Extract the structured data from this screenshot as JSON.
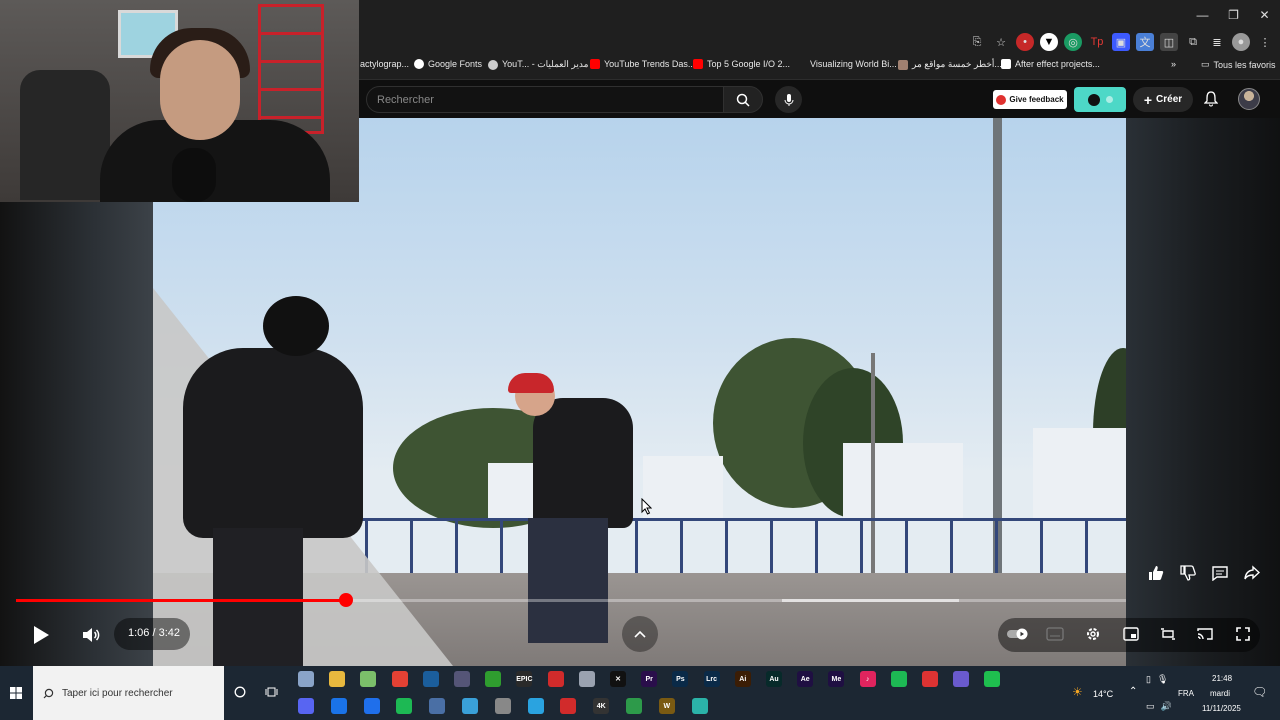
{
  "browser": {
    "window_controls": {
      "minimize": "—",
      "maximize": "❐",
      "close": "✕"
    },
    "bookmarks": [
      {
        "label": "actylograp...",
        "color": ""
      },
      {
        "label": "Google Fonts",
        "color": "#ffffff"
      },
      {
        "label": "YouT... - مدير العمليات",
        "color": "#cccccc"
      },
      {
        "label": "YouTube Trends Das...",
        "color": "#ff0000"
      },
      {
        "label": "Top 5 Google I/O 2...",
        "color": "#ff0000"
      },
      {
        "label": "Visualizing World Bi...",
        "color": ""
      },
      {
        "label": "أخطر خمسة مواقع مر...",
        "color": "#a08070"
      },
      {
        "label": "After effect projects...",
        "color": "#ffffff"
      }
    ],
    "bookmarks_more": "»",
    "all_bookmarks": "Tous les favoris"
  },
  "youtube": {
    "search": {
      "placeholder": "Rechercher"
    },
    "give_feedback": "Give feedback",
    "create_label": "Créer"
  },
  "player": {
    "current_time": "1:06",
    "duration": "3:42",
    "time_display": "1:06 / 3:42",
    "progress_fraction": 0.2973,
    "buffered_fraction": 0.51
  },
  "taskbar": {
    "search_placeholder": "Taper ici pour rechercher",
    "apps_row1": [
      {
        "name": "file-icon",
        "label": "",
        "color": "#8aa4c8"
      },
      {
        "name": "folder-icon",
        "label": "",
        "color": "#e8b83e"
      },
      {
        "name": "app-icon",
        "label": "",
        "color": "#7bbf6a"
      },
      {
        "name": "chrome-icon",
        "label": "",
        "color": "#e44134"
      },
      {
        "name": "steam-icon",
        "label": "",
        "color": "#1b5e9c"
      },
      {
        "name": "obs-icon",
        "label": "",
        "color": "#555577"
      },
      {
        "name": "xbox-icon",
        "label": "",
        "color": "#2f9d2f"
      },
      {
        "name": "epic-icon",
        "label": "EPIC",
        "color": "#2a2a2a"
      },
      {
        "name": "app-red-icon",
        "label": "",
        "color": "#d12b2b"
      },
      {
        "name": "app-cloud-icon",
        "label": "",
        "color": "#9aa2b0"
      },
      {
        "name": "capcut-icon",
        "label": "✕",
        "color": "#111111"
      },
      {
        "name": "premiere-icon",
        "label": "Pr",
        "color": "#2a0e4b"
      },
      {
        "name": "photoshop-icon",
        "label": "Ps",
        "color": "#0a2a48"
      },
      {
        "name": "lightroom-icon",
        "label": "Lrc",
        "color": "#0a2a48"
      },
      {
        "name": "illustrator-icon",
        "label": "Ai",
        "color": "#3b1d05"
      },
      {
        "name": "audition-icon",
        "label": "Au",
        "color": "#072a2a"
      },
      {
        "name": "aftereffects-icon",
        "label": "Ae",
        "color": "#1f0f42"
      },
      {
        "name": "mediaencoder-icon",
        "label": "Me",
        "color": "#1f0f42"
      },
      {
        "name": "tiktok-icon",
        "label": "♪",
        "color": "#e0245e"
      },
      {
        "name": "app-teal-icon",
        "label": "",
        "color": "#1db954"
      },
      {
        "name": "app-circle-icon",
        "label": "",
        "color": "#d33"
      },
      {
        "name": "app-purple-icon",
        "label": "",
        "color": "#6a5acd"
      },
      {
        "name": "app-green-icon",
        "label": "",
        "color": "#1fbf4f"
      }
    ],
    "apps_row2": [
      {
        "name": "discord-icon",
        "label": "",
        "color": "#5865f2"
      },
      {
        "name": "edge-icon",
        "label": "",
        "color": "#1a73e8"
      },
      {
        "name": "app-blue-icon",
        "label": "",
        "color": "#1f6feb"
      },
      {
        "name": "spotify-icon",
        "label": "",
        "color": "#1db954"
      },
      {
        "name": "app-window-icon",
        "label": "",
        "color": "#4a6fa5"
      },
      {
        "name": "app-x-icon",
        "label": "",
        "color": "#3aa0d8"
      },
      {
        "name": "app-brush-icon",
        "label": "",
        "color": "#888888"
      },
      {
        "name": "telegram-icon",
        "label": "",
        "color": "#2aa3e0"
      },
      {
        "name": "app-red2-icon",
        "label": "",
        "color": "#d12b2b"
      },
      {
        "name": "app-4k-icon",
        "label": "4K",
        "color": "#333333"
      },
      {
        "name": "app-leaf-icon",
        "label": "",
        "color": "#2d9a4a"
      },
      {
        "name": "wow-icon",
        "label": "W",
        "color": "#7a5a12"
      },
      {
        "name": "app-grid-icon",
        "label": "",
        "color": "#2bb3a8"
      }
    ],
    "weather": "14°C",
    "language": "FRA",
    "clock_time": "21:48",
    "clock_day": "mardi",
    "clock_date": "11/11/2025"
  }
}
